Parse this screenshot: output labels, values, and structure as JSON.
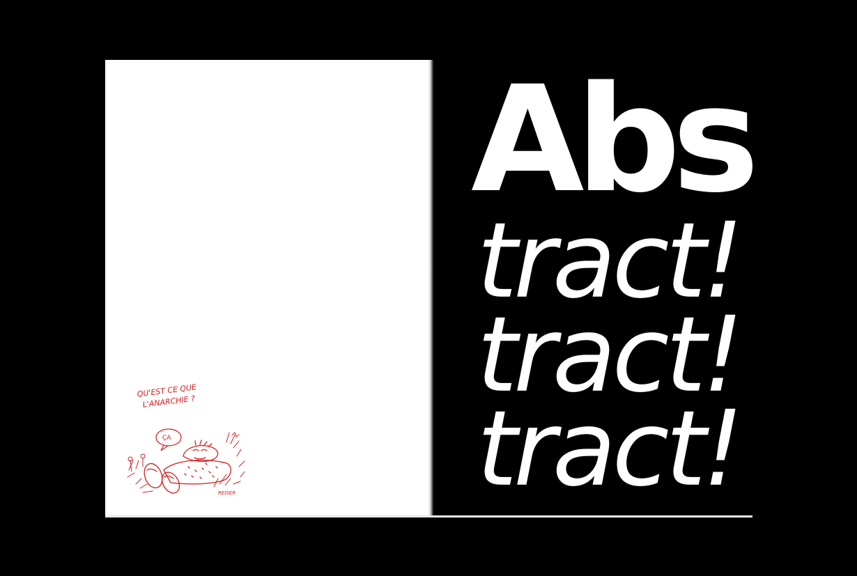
{
  "spread": {
    "colors": {
      "background": "#000000",
      "left_page": "#ffffff",
      "right_page": "#000000",
      "headline_text": "#ffffff",
      "cartoon_ink": "#d41c1c"
    },
    "right_page": {
      "headline": "Abs",
      "lines": [
        "tract!",
        "tract!",
        "tract!"
      ]
    },
    "left_page": {
      "cartoon": {
        "caption_line_1": "QU'EST CE QUE",
        "caption_line_2": "L'ANARCHIE ?",
        "speech_bubble": "ÇA",
        "signature": "REISER"
      }
    }
  }
}
